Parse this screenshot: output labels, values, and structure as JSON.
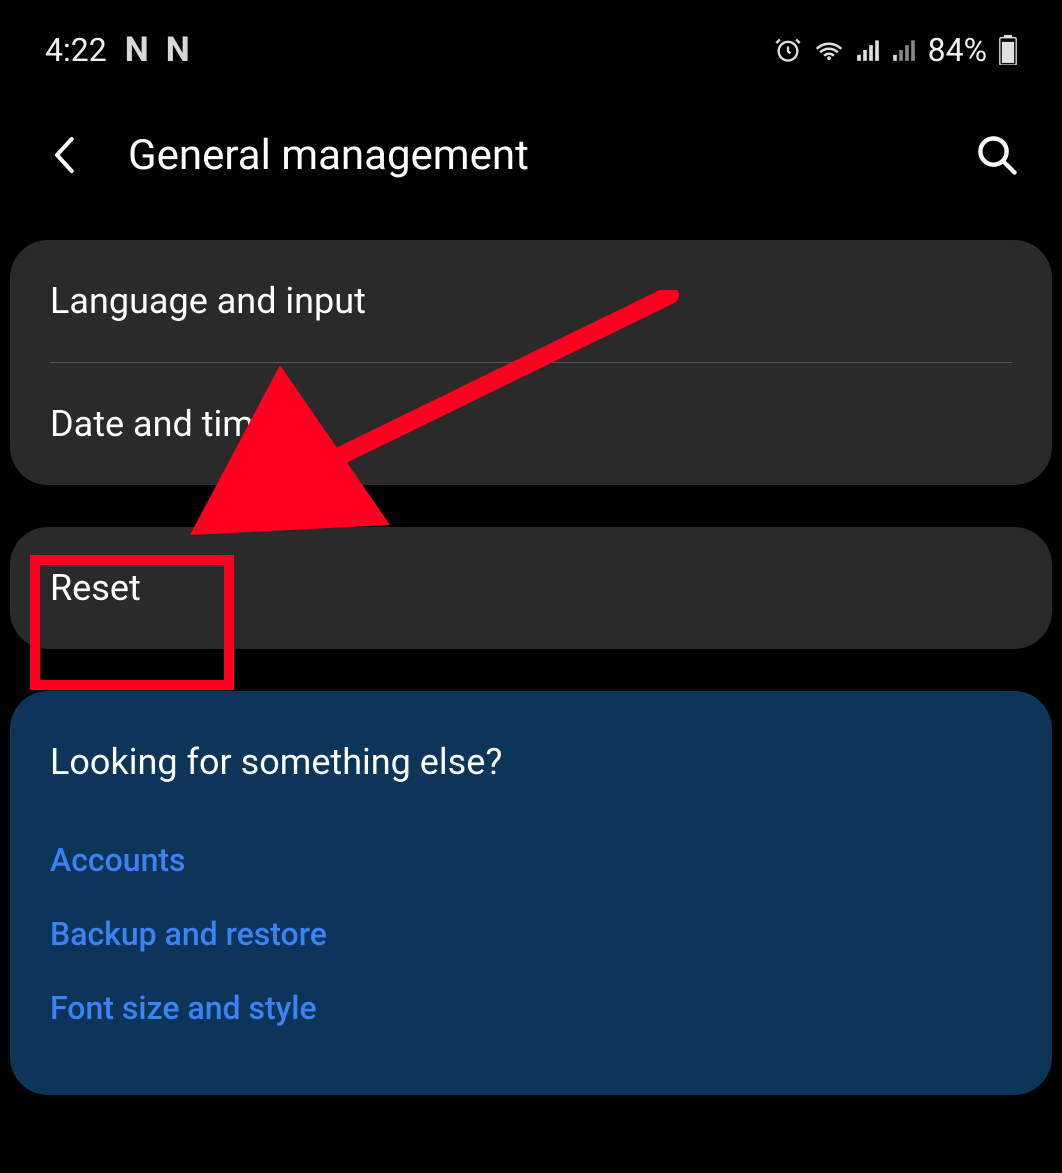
{
  "status": {
    "time": "4:22",
    "notif_icon1": "N",
    "notif_icon2": "N",
    "battery": "84%"
  },
  "header": {
    "title": "General management"
  },
  "settings": {
    "items": [
      {
        "label": "Language and input"
      },
      {
        "label": "Date and time"
      }
    ],
    "reset_label": "Reset"
  },
  "suggestions": {
    "title": "Looking for something else?",
    "links": [
      {
        "label": "Accounts"
      },
      {
        "label": "Backup and restore"
      },
      {
        "label": "Font size and style"
      }
    ]
  }
}
